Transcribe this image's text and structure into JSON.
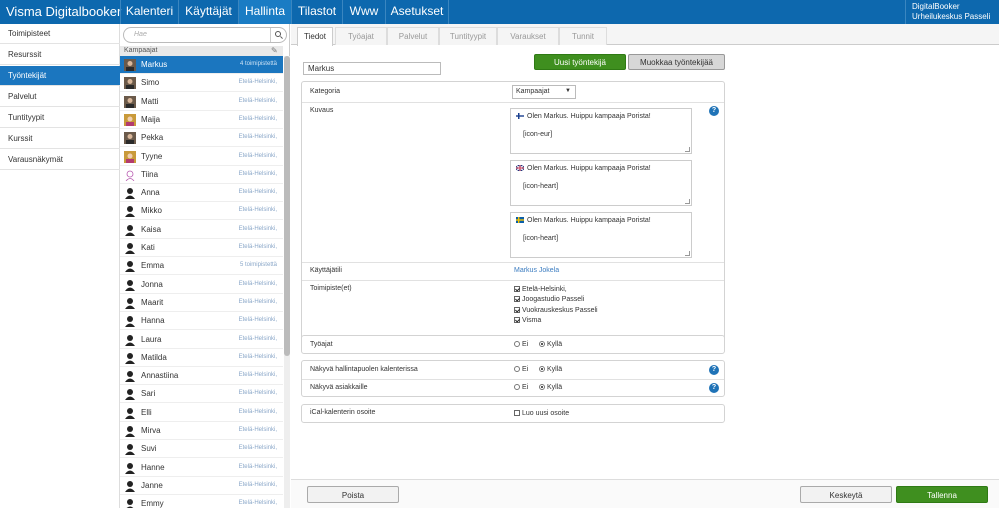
{
  "app": {
    "brand": "Visma Digitalbooker"
  },
  "topnav": [
    {
      "label": "Kalenteri"
    },
    {
      "label": "Käyttäjät"
    },
    {
      "label": "Hallinta"
    },
    {
      "label": "Tilastot"
    },
    {
      "label": "Www"
    },
    {
      "label": "Asetukset"
    }
  ],
  "user": {
    "line1": "DigitalBooker",
    "line2": "Urheilukeskus Passeli"
  },
  "sidebar": [
    {
      "label": "Toimipisteet"
    },
    {
      "label": "Resurssit"
    },
    {
      "label": "Työntekijät"
    },
    {
      "label": "Palvelut"
    },
    {
      "label": "Tuntityypit"
    },
    {
      "label": "Kurssit"
    },
    {
      "label": "Varausnäkymät"
    }
  ],
  "search": {
    "placeholder": "Hae"
  },
  "employees": {
    "group_label": "Kampaajat",
    "items": [
      {
        "name": "Markus",
        "loc": "4 toimipistettä",
        "avatar": "photo-man-icon"
      },
      {
        "name": "Simo",
        "loc": "Etelä-Helsinki,",
        "avatar": "photo-man-icon"
      },
      {
        "name": "Matti",
        "loc": "Etelä-Helsinki,",
        "avatar": "photo-man-icon"
      },
      {
        "name": "Maija",
        "loc": "Etelä-Helsinki,",
        "avatar": "photo-woman-icon"
      },
      {
        "name": "Pekka",
        "loc": "Etelä-Helsinki,",
        "avatar": "photo-man-icon"
      },
      {
        "name": "Tyyne",
        "loc": "Etelä-Helsinki,",
        "avatar": "photo-woman-icon"
      },
      {
        "name": "Tiina",
        "loc": "Etelä-Helsinki,",
        "avatar": "drawing-woman-icon"
      },
      {
        "name": "Anna",
        "loc": "Etelä-Helsinki,",
        "avatar": "silhouette-icon"
      },
      {
        "name": "Mikko",
        "loc": "Etelä-Helsinki,",
        "avatar": "silhouette-icon"
      },
      {
        "name": "Kaisa",
        "loc": "Etelä-Helsinki,",
        "avatar": "silhouette-icon"
      },
      {
        "name": "Kati",
        "loc": "Etelä-Helsinki,",
        "avatar": "silhouette-icon"
      },
      {
        "name": "Emma",
        "loc": "5 toimipistettä",
        "avatar": "silhouette-icon"
      },
      {
        "name": "Jonna",
        "loc": "Etelä-Helsinki,",
        "avatar": "silhouette-icon"
      },
      {
        "name": "Maarit",
        "loc": "Etelä-Helsinki,",
        "avatar": "silhouette-icon"
      },
      {
        "name": "Hanna",
        "loc": "Etelä-Helsinki,",
        "avatar": "silhouette-icon"
      },
      {
        "name": "Laura",
        "loc": "Etelä-Helsinki,",
        "avatar": "silhouette-icon"
      },
      {
        "name": "Matilda",
        "loc": "Etelä-Helsinki,",
        "avatar": "silhouette-icon"
      },
      {
        "name": "Annastiina",
        "loc": "Etelä-Helsinki,",
        "avatar": "silhouette-icon"
      },
      {
        "name": "Sari",
        "loc": "Etelä-Helsinki,",
        "avatar": "silhouette-icon"
      },
      {
        "name": "Elli",
        "loc": "Etelä-Helsinki,",
        "avatar": "silhouette-icon"
      },
      {
        "name": "Mirva",
        "loc": "Etelä-Helsinki,",
        "avatar": "silhouette-icon"
      },
      {
        "name": "Suvi",
        "loc": "Etelä-Helsinki,",
        "avatar": "silhouette-icon"
      },
      {
        "name": "Hanne",
        "loc": "Etelä-Helsinki,",
        "avatar": "silhouette-icon"
      },
      {
        "name": "Janne",
        "loc": "Etelä-Helsinki,",
        "avatar": "silhouette-icon"
      },
      {
        "name": "Emmy",
        "loc": "Etelä-Helsinki,",
        "avatar": "silhouette-icon"
      }
    ]
  },
  "tabs": [
    {
      "label": "Tiedot"
    },
    {
      "label": "Työajat"
    },
    {
      "label": "Palvelut"
    },
    {
      "label": "Tuntityypit"
    },
    {
      "label": "Varaukset"
    },
    {
      "label": "Tunnit"
    }
  ],
  "form": {
    "name_value": "Markus",
    "new_button": "Uusi työntekijä",
    "edit_button": "Muokkaa työntekijää",
    "category_label": "Kategoria",
    "category_value": "Kampaajat",
    "description_label": "Kuvaus",
    "descriptions": [
      {
        "flag": "fi-flag-icon",
        "line1": "Olen Markus. Huippu kampaaja Porista!",
        "line2": "[icon-eur]"
      },
      {
        "flag": "gb-flag-icon",
        "line1": "Olen Markus. Huippu kampaaja Porista!",
        "line2": "[icon-heart]"
      },
      {
        "flag": "se-flag-icon",
        "line1": "Olen Markus. Huippu kampaaja Porista!",
        "line2": "[icon-heart]"
      }
    ],
    "account_label": "Käyttäjätili",
    "account_value": "Markus Jokela",
    "locations_label": "Toimipiste(et)",
    "locations": [
      "Etelä-Helsinki,",
      "Joogastudio Passeli",
      "Vuokrauskeskus Passeli",
      "Visma"
    ],
    "worktime_label": "Työajat",
    "admin_cal_label": "Näkyvä hallintapuolen kalenterissa",
    "customers_label": "Näkyvä asiakkaille",
    "opt_no": "Ei",
    "opt_yes": "Kyllä",
    "ical_label": "iCal-kalenterin osoite",
    "ical_option": "Luo uusi osoite",
    "help_glyph": "?"
  },
  "footer": {
    "delete": "Poista",
    "cancel": "Keskeytä",
    "save": "Tallenna"
  },
  "colors": {
    "primary": "#0d68ae",
    "active": "#1b76bf",
    "green": "#3f8f1f"
  }
}
